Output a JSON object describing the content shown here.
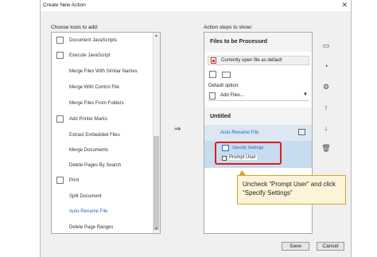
{
  "window": {
    "title": "Create New Action",
    "close_label": "✕"
  },
  "left": {
    "heading": "Choose tools to add:",
    "items": [
      {
        "label": "Document JavaScripts",
        "icon": "document-icon"
      },
      {
        "label": "Execute JavaScript",
        "icon": "script-icon"
      },
      {
        "label": "Merge Files With Similar Names",
        "icon": ""
      },
      {
        "label": "Merge With Control File",
        "icon": ""
      },
      {
        "label": "Merge Files From Folders",
        "icon": ""
      },
      {
        "label": "Add Printer Marks",
        "icon": "printer-marks-icon"
      },
      {
        "label": "Extract Embedded Files",
        "icon": ""
      },
      {
        "label": "Merge Documents",
        "icon": ""
      },
      {
        "label": "Delete Pages By Search",
        "icon": ""
      },
      {
        "label": "Print",
        "icon": "print-icon"
      },
      {
        "label": "Split Document",
        "icon": ""
      },
      {
        "label": "Auto-Rename File",
        "icon": "",
        "active": true
      },
      {
        "label": "Delete Page Ranges",
        "icon": ""
      }
    ]
  },
  "right": {
    "heading": "Action steps to show:",
    "files_section": "Files to be Processed",
    "current_file": "Currently open file as default",
    "default_option_label": "Default option:",
    "add_files": "Add Files...",
    "untitled_section": "Untitled",
    "task": "Auto-Rename File",
    "specify_settings": "Specify Settings",
    "prompt_user": "Prompt User"
  },
  "callout": {
    "text": "Uncheck “Prompt User” and click “Specify Settings”"
  },
  "footer": {
    "save": "Save",
    "cancel": "Cancel"
  },
  "colors": {
    "accent": "#2a66c9",
    "highlight": "#e01c1c",
    "callout_bg": "#fdf3d9"
  }
}
